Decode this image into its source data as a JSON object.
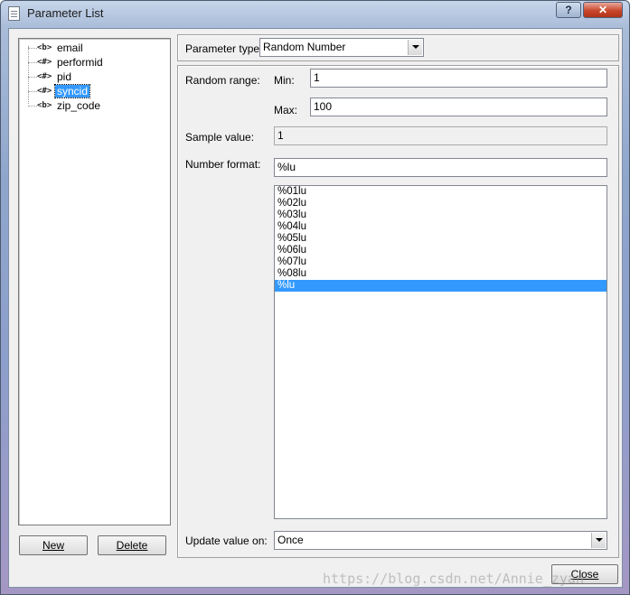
{
  "window": {
    "title": "Parameter List",
    "help_label": "?",
    "close_label": "✕"
  },
  "tree": {
    "items": [
      {
        "type": "<b>",
        "label": "email"
      },
      {
        "type": "<#>",
        "label": "performid"
      },
      {
        "type": "<#>",
        "label": "pid"
      },
      {
        "type": "<#>",
        "label": "syncid",
        "selected": true
      },
      {
        "type": "<b>",
        "label": "zip_code"
      }
    ]
  },
  "buttons": {
    "new": "New",
    "delete": "Delete",
    "close": "Close"
  },
  "parameter_type": {
    "label": "Parameter type:",
    "value": "Random Number"
  },
  "random_range": {
    "label": "Random range:",
    "min_label": "Min:",
    "min_value": "1",
    "max_label": "Max:",
    "max_value": "100"
  },
  "sample_value": {
    "label": "Sample value:",
    "value": "1"
  },
  "number_format": {
    "label": "Number format:",
    "value": "%lu",
    "options": [
      "%01lu",
      "%02lu",
      "%03lu",
      "%04lu",
      "%05lu",
      "%06lu",
      "%07lu",
      "%08lu",
      "%lu"
    ],
    "selected": "%lu"
  },
  "update_value": {
    "label": "Update value on:",
    "value": "Once"
  },
  "watermark": "https://blog.csdn.net/Annie_zyan",
  "colors": {
    "selection": "#3399ff",
    "close_button": "#c9472c"
  }
}
